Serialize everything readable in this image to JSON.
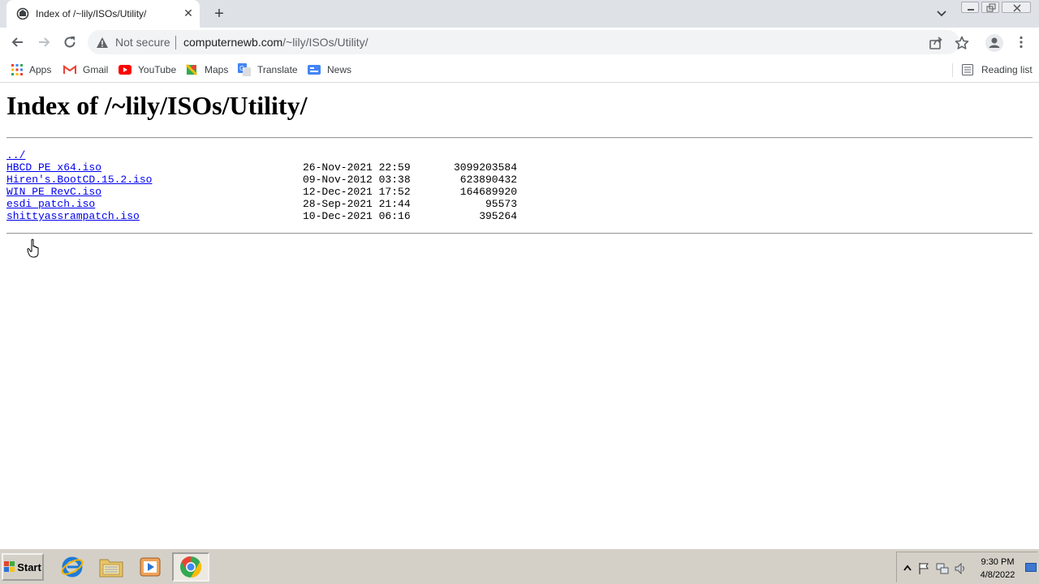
{
  "browser": {
    "tab": {
      "title": "Index of /~lily/ISOs/Utility/",
      "close_icon": "close-icon",
      "favicon": "site-icon"
    },
    "new_tab_icon": "plus-icon",
    "omnibox": {
      "security_label": "Not secure",
      "url_host": "computernewb.com",
      "url_path": "/~lily/ISOs/Utility/"
    },
    "bookmarks": [
      {
        "label": "Apps",
        "icon": "apps-grid-icon"
      },
      {
        "label": "Gmail",
        "icon": "gmail-icon"
      },
      {
        "label": "YouTube",
        "icon": "youtube-icon"
      },
      {
        "label": "Maps",
        "icon": "maps-icon"
      },
      {
        "label": "Translate",
        "icon": "translate-icon"
      },
      {
        "label": "News",
        "icon": "news-icon"
      }
    ],
    "reading_list": "Reading list"
  },
  "page": {
    "title": "Index of /~lily/ISOs/Utility/",
    "parent_link": "../",
    "entries": [
      {
        "name": "HBCD_PE_x64.iso",
        "date": "26-Nov-2021 22:59",
        "size": "3099203584"
      },
      {
        "name": "Hiren's.BootCD.15.2.iso",
        "date": "09-Nov-2012 03:38",
        "size": "623890432"
      },
      {
        "name": "WIN_PE_RevC.iso",
        "date": "12-Dec-2021 17:52",
        "size": "164689920"
      },
      {
        "name": "esdi_patch.iso",
        "date": "28-Sep-2021 21:44",
        "size": "95573"
      },
      {
        "name": "shittyassrampatch.iso",
        "date": "10-Dec-2021 06:16",
        "size": "395264"
      }
    ]
  },
  "taskbar": {
    "start_label": "Start",
    "apps": [
      "internet-explorer-icon",
      "file-explorer-icon",
      "media-player-icon",
      "chrome-icon"
    ],
    "clock": {
      "time": "9:30 PM",
      "date": "4/8/2022"
    }
  },
  "colors": {
    "tabstrip": "#dee1e6",
    "link": "#0000ee",
    "taskbar": "#d4d0c8"
  }
}
